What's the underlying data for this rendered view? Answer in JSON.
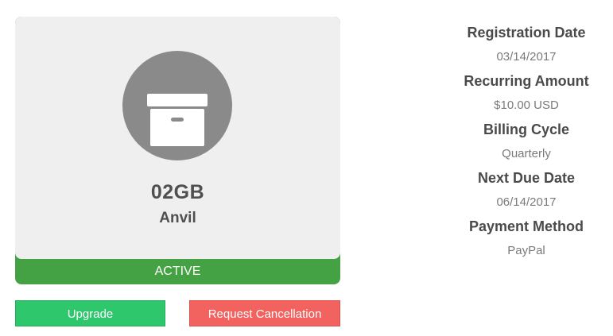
{
  "product": {
    "size": "02GB",
    "name": "Anvil",
    "status": "ACTIVE",
    "icon": "archive-box-icon"
  },
  "actions": {
    "upgrade_label": "Upgrade",
    "cancel_label": "Request Cancellation"
  },
  "details": [
    {
      "label": "Registration Date",
      "value": "03/14/2017"
    },
    {
      "label": "Recurring Amount",
      "value": "$10.00 USD"
    },
    {
      "label": "Billing Cycle",
      "value": "Quarterly"
    },
    {
      "label": "Next Due Date",
      "value": "06/14/2017"
    },
    {
      "label": "Payment Method",
      "value": "PayPal"
    }
  ],
  "colors": {
    "card_background": "#efefef",
    "icon_circle": "#8a8a8a",
    "status_active": "#45a244",
    "upgrade_button": "#2ec76b",
    "cancel_button": "#f2625e"
  }
}
